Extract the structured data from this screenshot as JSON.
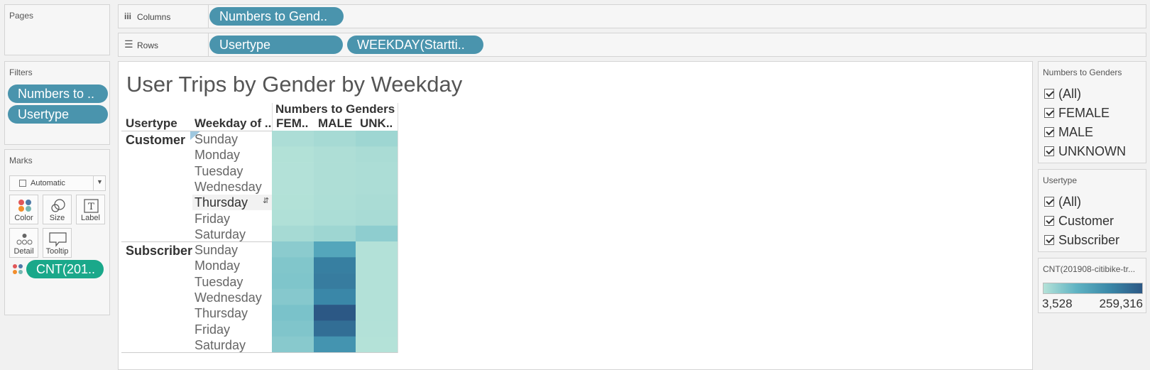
{
  "pages_card": {
    "title": "Pages"
  },
  "columns_shelf": {
    "label": "Columns",
    "pills": [
      "Numbers to Gend.."
    ]
  },
  "rows_shelf": {
    "label": "Rows",
    "pills": [
      "Usertype",
      "WEEKDAY(Startti.."
    ]
  },
  "filters_card": {
    "title": "Filters",
    "pills": [
      "Numbers to ..",
      "Usertype"
    ]
  },
  "marks_card": {
    "title": "Marks",
    "mark_type": "Automatic",
    "buttons": [
      "Color",
      "Size",
      "Label",
      "Detail",
      "Tooltip"
    ],
    "field_pill": "CNT(201.."
  },
  "view": {
    "title": "User Trips by Gender by Weekday",
    "row_headers": [
      "Usertype",
      "Weekday of .."
    ],
    "column_group_header": "Numbers to Genders",
    "column_headers": [
      "FEM..",
      "MALE",
      "UNK.."
    ],
    "groups": [
      {
        "name": "Customer",
        "rows": [
          "Sunday",
          "Monday",
          "Tuesday",
          "Wednesday",
          "Thursday",
          "Friday",
          "Saturday"
        ]
      },
      {
        "name": "Subscriber",
        "rows": [
          "Sunday",
          "Monday",
          "Tuesday",
          "Wednesday",
          "Thursday",
          "Friday",
          "Saturday"
        ]
      }
    ]
  },
  "gender_filter": {
    "title": "Numbers to Genders",
    "items": [
      "(All)",
      "FEMALE",
      "MALE",
      "UNKNOWN"
    ]
  },
  "usertype_filter": {
    "title": "Usertype",
    "items": [
      "(All)",
      "Customer",
      "Subscriber"
    ]
  },
  "color_legend": {
    "title": "CNT(201908-citibike-tr...",
    "min_label": "3,528",
    "max_label": "259,316",
    "color_low": "#b4e2d8",
    "color_high": "#2c5885"
  },
  "chart_data": {
    "type": "heatmap",
    "title": "User Trips by Gender by Weekday",
    "columns": [
      "FEM..",
      "MALE",
      "UNK.."
    ],
    "rows": [
      "Customer / Sunday",
      "Customer / Monday",
      "Customer / Tuesday",
      "Customer / Wednesday",
      "Customer / Thursday",
      "Customer / Friday",
      "Customer / Saturday",
      "Subscriber / Sunday",
      "Subscriber / Monday",
      "Subscriber / Tuesday",
      "Subscriber / Wednesday",
      "Subscriber / Thursday",
      "Subscriber / Friday",
      "Subscriber / Saturday"
    ],
    "values": [
      [
        12000,
        18000,
        26000
      ],
      [
        6000,
        10000,
        14000
      ],
      [
        5000,
        10000,
        12000
      ],
      [
        5000,
        10000,
        12000
      ],
      [
        6000,
        11000,
        14000
      ],
      [
        8000,
        13000,
        16000
      ],
      [
        18000,
        26000,
        42000
      ],
      [
        45000,
        115000,
        5000
      ],
      [
        55000,
        190000,
        5000
      ],
      [
        57000,
        195000,
        5000
      ],
      [
        50000,
        175000,
        5000
      ],
      [
        62000,
        259316,
        5000
      ],
      [
        56000,
        220000,
        4500
      ],
      [
        48000,
        150000,
        3528
      ]
    ],
    "color_range": [
      3528,
      259316
    ]
  }
}
